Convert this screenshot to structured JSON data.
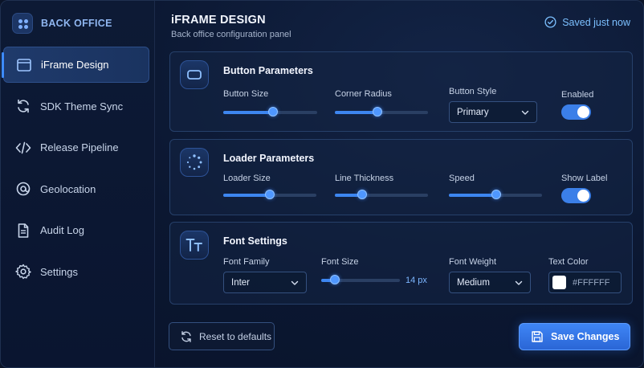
{
  "brand": {
    "name": "BACK OFFICE",
    "icon": "grid-dots-icon"
  },
  "sidebar": {
    "items": [
      {
        "label": "iFrame Design",
        "icon": "window-icon",
        "active": true
      },
      {
        "label": "SDK Theme Sync",
        "icon": "sync-icon",
        "active": false
      },
      {
        "label": "Release Pipeline",
        "icon": "code-icon",
        "active": false
      },
      {
        "label": "Geolocation",
        "icon": "at-location-icon",
        "active": false
      },
      {
        "label": "Audit Log",
        "icon": "document-icon",
        "active": false
      },
      {
        "label": "Settings",
        "icon": "gear-icon",
        "active": false
      }
    ]
  },
  "header": {
    "title": "iFRAME DESIGN",
    "subtitle": "Back office configuration panel",
    "status": "Saved just now",
    "status_icon": "check-circle-icon"
  },
  "button_params": {
    "title": "Button Parameters",
    "icon": "button-shape-icon",
    "size": {
      "label": "Button Size",
      "value": 0.53
    },
    "radius": {
      "label": "Corner Radius",
      "value": 0.46
    },
    "style": {
      "label": "Button Style",
      "value": "Primary"
    },
    "enabled": {
      "label": "Enabled",
      "on": true
    }
  },
  "loader_params": {
    "title": "Loader Parameters",
    "icon": "spinner-icon",
    "size": {
      "label": "Loader Size",
      "value": 0.5
    },
    "thickness": {
      "label": "Line Thickness",
      "value": 0.29
    },
    "speed": {
      "label": "Speed",
      "value": 0.51
    },
    "show_label": {
      "label": "Show Label",
      "on": true
    }
  },
  "font_settings": {
    "title": "Font Settings",
    "icon": "text-tt-icon",
    "family": {
      "label": "Font Family",
      "value": "Inter"
    },
    "size": {
      "label": "Font Size",
      "value": 0.17,
      "display": "14 px"
    },
    "weight": {
      "label": "Font Weight",
      "value": "Medium"
    },
    "color": {
      "label": "Text Color",
      "value": "#FFFFFF",
      "swatch": "#ffffff"
    }
  },
  "footer": {
    "reset_label": "Reset to defaults",
    "save_label": "Save Changes"
  },
  "colors": {
    "accent": "#3d86f0",
    "background": "#0b1731"
  }
}
